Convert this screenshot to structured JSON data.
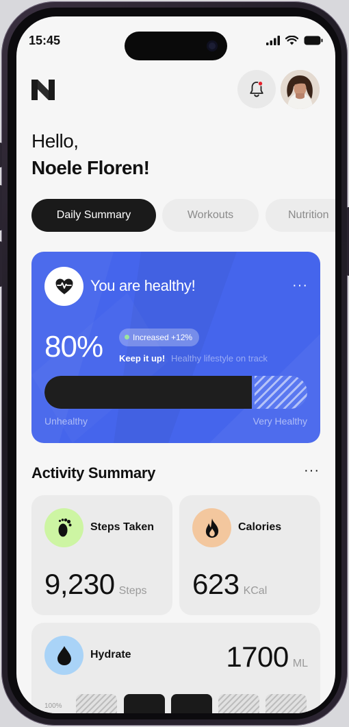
{
  "status": {
    "time": "15:45"
  },
  "header": {
    "greeting": "Hello,",
    "user_name": "Noele Floren!"
  },
  "tabs": [
    {
      "label": "Daily Summary",
      "active": true
    },
    {
      "label": "Workouts",
      "active": false
    },
    {
      "label": "Nutrition",
      "active": false
    }
  ],
  "health_card": {
    "title": "You are healthy!",
    "percent_text": "80%",
    "percent_value": 0.8,
    "badge": "Increased +12%",
    "encourage": "Keep it up!",
    "encourage_sub": "Healthy lifestyle on track",
    "scale_low": "Unhealthy",
    "scale_high": "Very Healthy",
    "more": "···",
    "accent": "#4565ec"
  },
  "activity": {
    "title": "Activity Summary",
    "more": "···",
    "steps": {
      "label": "Steps Taken",
      "value": "9,230",
      "unit": "Steps",
      "icon": "footprints-icon",
      "color": "#cdf5a3"
    },
    "calories": {
      "label": "Calories",
      "value": "623",
      "unit": "KCal",
      "icon": "flame-icon",
      "color": "#f3c79e"
    },
    "hydrate": {
      "label": "Hydrate",
      "value": "1700",
      "unit": "ML",
      "icon": "water-drop-icon",
      "color": "#a9d3f7",
      "scale_label": "100%"
    }
  }
}
